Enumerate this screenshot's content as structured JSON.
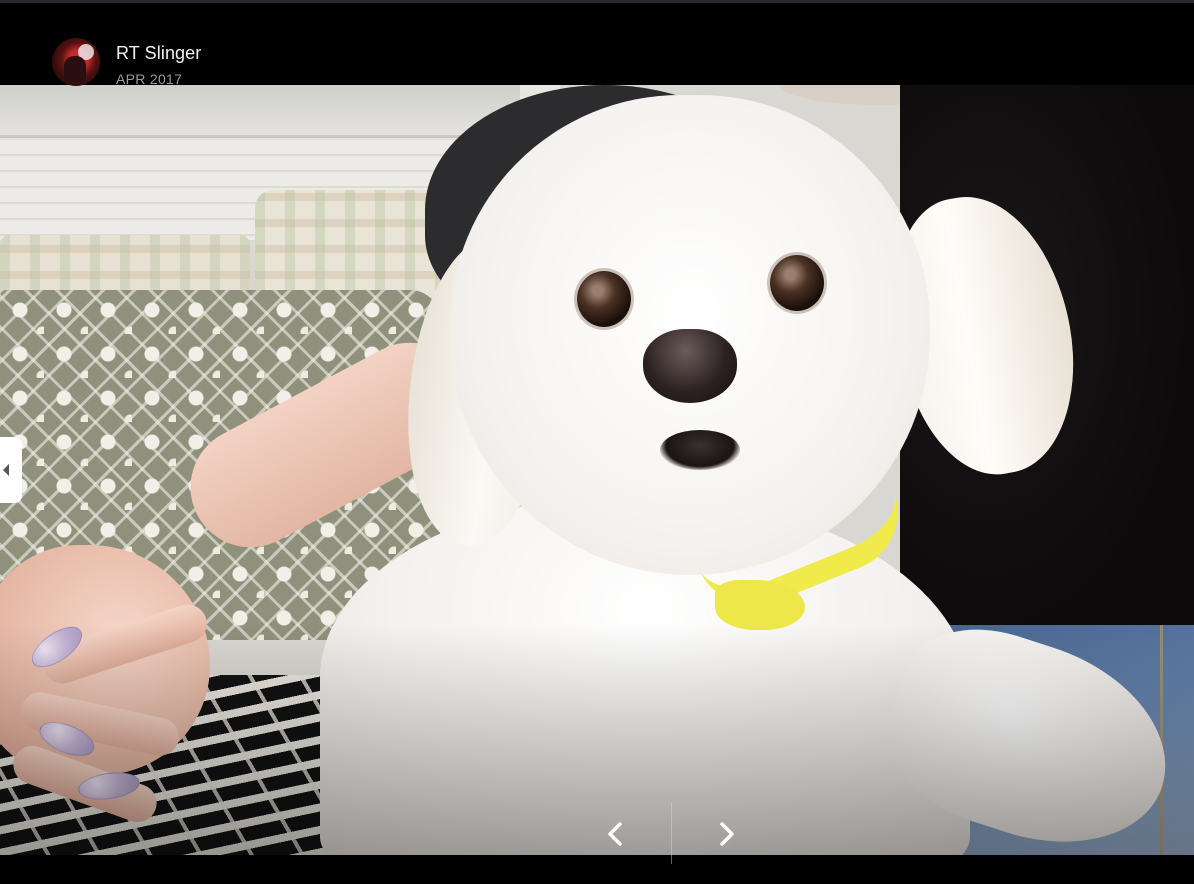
{
  "post": {
    "author": "RT Slinger",
    "date": "APR 2017"
  },
  "icons": {
    "avatar": "profile-photo",
    "side_handle": "caret-left-icon",
    "prev": "chevron-left-icon",
    "next": "chevron-right-icon"
  },
  "colors": {
    "background": "#000000",
    "author_text": "#f2f2f2",
    "date_text": "#9a9a9a",
    "control_icon": "#ffffff"
  }
}
